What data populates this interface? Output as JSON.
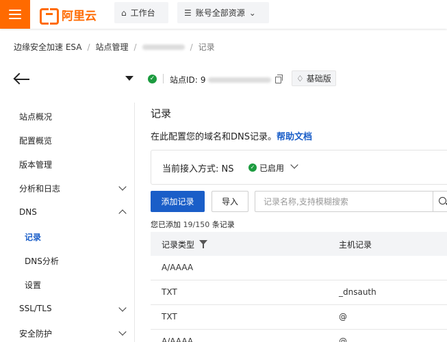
{
  "topbar": {
    "brand": "阿里云",
    "workbench": "工作台",
    "resources": "账号全部资源"
  },
  "breadcrumb": {
    "product": "边缘安全加速 ESA",
    "sites": "站点管理",
    "current": "记录"
  },
  "site": {
    "id_label": "站点ID:",
    "id_prefix": "9",
    "plan": "基础版"
  },
  "sidebar": {
    "items": [
      {
        "label": "站点概况"
      },
      {
        "label": "配置概览"
      },
      {
        "label": "版本管理"
      },
      {
        "label": "分析和日志"
      },
      {
        "label": "DNS"
      },
      {
        "label": "记录"
      },
      {
        "label": "DNS分析"
      },
      {
        "label": "设置"
      },
      {
        "label": "SSL/TLS"
      },
      {
        "label": "安全防护"
      }
    ]
  },
  "main": {
    "title": "记录",
    "intro": "在此配置您的域名和DNS记录。",
    "help_link": "帮助文档",
    "access_label": "当前接入方式: NS",
    "access_status": "已启用",
    "add_button": "添加记录",
    "import_button": "导入",
    "search_placeholder": "记录名称,支持模糊搜索",
    "count_prefix": "您已添加",
    "count_value": "19/150",
    "count_suffix": "条记录"
  },
  "table": {
    "columns": [
      "记录类型",
      "主机记录"
    ],
    "rows": [
      {
        "type": "A/AAAA",
        "host": ""
      },
      {
        "type": "TXT",
        "host": "_dnsauth"
      },
      {
        "type": "TXT",
        "host": "@"
      },
      {
        "type": "A/AAAA",
        "host": "@"
      }
    ]
  },
  "colors": {
    "brand_orange": "#ff6a00",
    "primary_blue": "#1a5ec8",
    "success_green": "#1c9b3f"
  }
}
